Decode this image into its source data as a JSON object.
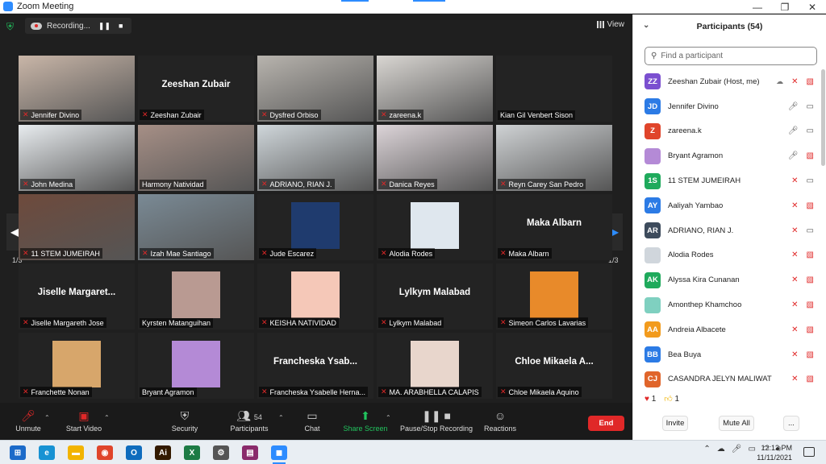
{
  "window": {
    "title": "Zoom Meeting",
    "minimize": "—",
    "maximize": "❐",
    "close": "✕"
  },
  "meeting": {
    "recording_label": "Recording...",
    "view_label": "View",
    "page_left": "1/3",
    "page_right": "1/3",
    "tiles": [
      {
        "name": "Jennifer Divino",
        "center": "",
        "type": "video",
        "bg": "#c9b6a8",
        "active": true
      },
      {
        "name": "Zeeshan Zubair",
        "center": "Zeeshan Zubair",
        "type": "name"
      },
      {
        "name": "Dysfred Orbiso",
        "center": "",
        "type": "video",
        "bg": "#b8b4ae"
      },
      {
        "name": "zareena.k",
        "center": "",
        "type": "video",
        "bg": "#d9d6d2"
      },
      {
        "name": "Kian Gil Venbert Sison",
        "center": "",
        "type": "blank",
        "nomic": true
      },
      {
        "name": "John Medina",
        "center": "",
        "type": "video",
        "bg": "#e8ecef"
      },
      {
        "name": "Harmony Natividad",
        "center": "",
        "type": "video",
        "bg": "#a68f86",
        "nomic": true
      },
      {
        "name": "ADRIANO, RIAN J.",
        "center": "",
        "type": "video",
        "bg": "#cfd6da"
      },
      {
        "name": "Danica Reyes",
        "center": "",
        "type": "video",
        "bg": "#dcd4d8"
      },
      {
        "name": "Reyn Carey San Pedro",
        "center": "",
        "type": "video",
        "bg": "#cfd2d4"
      },
      {
        "name": "11 STEM JUMEIRAH",
        "center": "",
        "type": "video",
        "bg": "#6e4a3c"
      },
      {
        "name": "Izah Mae Santiago",
        "center": "",
        "type": "video",
        "bg": "#7a8a95"
      },
      {
        "name": "Jude Escarez",
        "center": "",
        "type": "avatar",
        "bg": "#1f3b6e"
      },
      {
        "name": "Alodia Rodes",
        "center": "",
        "type": "avatar",
        "bg": "#dfe7ee"
      },
      {
        "name": "Maka Albarn",
        "center": "Maka Albarn",
        "type": "name"
      },
      {
        "name": "Jiselle Margareth Jose",
        "center": "Jiselle  Margaret...",
        "type": "name"
      },
      {
        "name": "Kyrsten Matanguihan",
        "center": "",
        "type": "avatar",
        "bg": "#b99a92",
        "nomic": true
      },
      {
        "name": "KEISHA NATIVIDAD",
        "center": "",
        "type": "avatar",
        "bg": "#f5c8b8"
      },
      {
        "name": "Lylkym Malabad",
        "center": "Lylkym Malabad",
        "type": "name"
      },
      {
        "name": "Simeon Carlos Lavarias",
        "center": "",
        "type": "avatar",
        "bg": "#e88a2a"
      },
      {
        "name": "Franchette Nonan",
        "center": "",
        "type": "avatar",
        "bg": "#d7a66b"
      },
      {
        "name": "Bryant Agramon",
        "center": "",
        "type": "avatar",
        "bg": "#b48ad6",
        "nomic": true
      },
      {
        "name": "Francheska Ysabelle Herna...",
        "center": "Francheska  Ysab...",
        "type": "name"
      },
      {
        "name": "MA. ARABHELLA CALAPIS",
        "center": "",
        "type": "avatar",
        "bg": "#e8d6cc"
      },
      {
        "name": "Chloe Mikaela Aquino",
        "center": "Chloe  Mikaela  A...",
        "type": "name"
      }
    ]
  },
  "toolbar": {
    "unmute": "Unmute",
    "start_video": "Start Video",
    "security": "Security",
    "participants": "Participants",
    "participants_count": "54",
    "chat": "Chat",
    "share_screen": "Share Screen",
    "pause_stop_recording": "Pause/Stop Recording",
    "reactions": "Reactions",
    "end": "End"
  },
  "panel": {
    "title": "Participants (54)",
    "search_placeholder": "Find a participant",
    "participants": [
      {
        "initials": "ZZ",
        "name": "Zeeshan Zubair (Host, me)",
        "color": "#7b4fd0",
        "mic": "off",
        "video": "off",
        "cloud": true
      },
      {
        "initials": "JD",
        "name": "Jennifer Divino",
        "color": "#2c7be5",
        "mic": "on",
        "video": "on"
      },
      {
        "initials": "Z",
        "name": "zareena.k",
        "color": "#e0452b",
        "mic": "on",
        "video": "on"
      },
      {
        "initials": "",
        "name": "Bryant Agramon",
        "color": "#b48ad6",
        "mic": "on",
        "video": "off"
      },
      {
        "initials": "1S",
        "name": "11 STEM JUMEIRAH",
        "color": "#1faa5c",
        "mic": "off",
        "video": "on"
      },
      {
        "initials": "AY",
        "name": "Aaliyah Yambao",
        "color": "#2c7be5",
        "mic": "off",
        "video": "off"
      },
      {
        "initials": "AR",
        "name": "ADRIANO, RIAN J.",
        "color": "#3d4b5c",
        "mic": "off",
        "video": "on"
      },
      {
        "initials": "",
        "name": "Alodia Rodes",
        "color": "#d0d6dc",
        "mic": "off",
        "video": "off"
      },
      {
        "initials": "AK",
        "name": "Alyssa Kira Cunanan",
        "color": "#1faa5c",
        "mic": "off",
        "video": "off"
      },
      {
        "initials": "",
        "name": "Amonthep Khamchoo",
        "color": "#7fd0c0",
        "mic": "off",
        "video": "off"
      },
      {
        "initials": "AA",
        "name": "Andreia Albacete",
        "color": "#f29b1d",
        "mic": "off",
        "video": "off"
      },
      {
        "initials": "BB",
        "name": "Bea Buya",
        "color": "#2c7be5",
        "mic": "off",
        "video": "off"
      },
      {
        "initials": "CJ",
        "name": "CASANDRA JELYN MALIWAT",
        "color": "#e0652b",
        "mic": "off",
        "video": "off"
      }
    ],
    "reactions": {
      "heart_count": "1",
      "thumb_count": "1"
    },
    "invite": "Invite",
    "mute_all": "Mute All",
    "more": "..."
  },
  "taskbar": {
    "time": "12:13 PM",
    "date": "11/11/2021",
    "apps": [
      {
        "id": "start",
        "glyph": "⊞",
        "color": "#1b6ac9"
      },
      {
        "id": "edge",
        "glyph": "e",
        "color": "#1792d3"
      },
      {
        "id": "files",
        "glyph": "▬",
        "color": "#f2b400"
      },
      {
        "id": "chrome",
        "glyph": "◉",
        "color": "#e0452b"
      },
      {
        "id": "outlook",
        "glyph": "O",
        "color": "#0f6cbd"
      },
      {
        "id": "illustrator",
        "glyph": "Ai",
        "color": "#331a00"
      },
      {
        "id": "excel",
        "glyph": "X",
        "color": "#1d7b45"
      },
      {
        "id": "settings",
        "glyph": "⚙",
        "color": "#555"
      },
      {
        "id": "winrar",
        "glyph": "▤",
        "color": "#8a2a6b"
      },
      {
        "id": "zoom",
        "glyph": "◼",
        "color": "#2d8cff",
        "active": true
      }
    ]
  }
}
